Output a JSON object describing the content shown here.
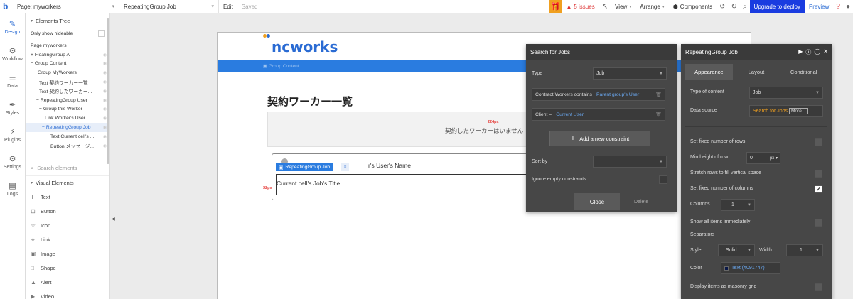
{
  "topbar": {
    "logo": "b",
    "page_select": "Page: myworkers",
    "element_select": "RepeatingGroup Job",
    "edit": "Edit",
    "saved": "Saved",
    "issues": "5 issues",
    "view": "View",
    "arrange": "Arrange",
    "components": "Components",
    "upgrade": "Upgrade to deploy",
    "preview": "Preview"
  },
  "leftnav": {
    "items": [
      {
        "label": "Design",
        "icon": "design-icon",
        "glyph": "✎"
      },
      {
        "label": "Workflow",
        "icon": "workflow-icon",
        "glyph": "⚙"
      },
      {
        "label": "Data",
        "icon": "data-icon",
        "glyph": "☰"
      },
      {
        "label": "Styles",
        "icon": "brush-icon",
        "glyph": "✒"
      },
      {
        "label": "Plugins",
        "icon": "plug-icon",
        "glyph": "⚡"
      },
      {
        "label": "Settings",
        "icon": "gear-icon",
        "glyph": "⚙"
      },
      {
        "label": "Logs",
        "icon": "logs-icon",
        "glyph": "▤"
      }
    ]
  },
  "elements_panel": {
    "title": "Elements Tree",
    "only_show_hideable": "Only show hideable",
    "tree": [
      {
        "label": "Page myworkers",
        "indent": 0,
        "selected": false
      },
      {
        "label": "+ FloatingGroup A",
        "indent": 0,
        "selected": false
      },
      {
        "label": "− Group Content",
        "indent": 0,
        "selected": false
      },
      {
        "label": "− Group MyWorkers",
        "indent": 1,
        "selected": false
      },
      {
        "label": "Text 契約ワーカー一覧",
        "indent": 3,
        "selected": false
      },
      {
        "label": "Text 契約したワーカー...",
        "indent": 3,
        "selected": false
      },
      {
        "label": "− RepeatingGroup User",
        "indent": 2,
        "selected": false
      },
      {
        "label": "− Group this Worker",
        "indent": 3,
        "selected": false
      },
      {
        "label": "Link Worker's User",
        "indent": 5,
        "selected": false
      },
      {
        "label": "− RepeatingGroup Job",
        "indent": 4,
        "selected": true
      },
      {
        "label": "Text Current cell's ...",
        "indent": 7,
        "selected": false
      },
      {
        "label": "Button メッセージ...",
        "indent": 7,
        "selected": false
      }
    ],
    "search_placeholder": "Search elements",
    "visual_elements_title": "Visual Elements",
    "visual_elements": [
      {
        "label": "Text",
        "glyph": "T",
        "icon": "text-icon"
      },
      {
        "label": "Button",
        "glyph": "⊡",
        "icon": "button-icon"
      },
      {
        "label": "Icon",
        "glyph": "☆",
        "icon": "star-icon"
      },
      {
        "label": "Link",
        "glyph": "⚭",
        "icon": "link-icon"
      },
      {
        "label": "Image",
        "glyph": "▣",
        "icon": "image-icon"
      },
      {
        "label": "Shape",
        "glyph": "□",
        "icon": "shape-icon"
      },
      {
        "label": "Alert",
        "glyph": "▲",
        "icon": "alert-icon"
      },
      {
        "label": "Video",
        "glyph": "▶",
        "icon": "video-icon"
      }
    ]
  },
  "canvas": {
    "logo": "ncworks",
    "band_label": "▣ Group Content",
    "page_title": "契約ワーカー一覧",
    "empty_text": "契約したワーカーはいません",
    "card_text1": "r's User's Name",
    "card_text2": "Current cell's Job's Title",
    "rg_chip": "RepeatingGroup Job",
    "guide_224": "224px",
    "guide_32": "32px"
  },
  "search_panel": {
    "title": "Search for Jobs",
    "type_label": "Type",
    "type_value": "Job",
    "constraint1_label": "Contract Workers contains",
    "constraint1_value": "Parent group's User",
    "constraint2_label": "Client =",
    "constraint2_value": "Current User",
    "add_constraint": "Add a new constraint",
    "sort_by": "Sort by",
    "ignore_empty": "Ignore empty constraints",
    "close": "Close",
    "delete": "Delete"
  },
  "property_editor": {
    "title": "RepeatingGroup Job",
    "tabs": [
      "Appearance",
      "Layout",
      "Conditional"
    ],
    "type_of_content_label": "Type of content",
    "type_of_content_value": "Job",
    "data_source_label": "Data source",
    "data_source_value": "Search for Jobs",
    "data_source_more": "More...",
    "fixed_rows": "Set fixed number of rows",
    "min_height": "Min height of row",
    "min_height_value": "0",
    "min_height_unit": "px",
    "stretch_rows": "Stretch rows to fill vertical space",
    "fixed_columns": "Set fixed number of columns",
    "columns_label": "Columns",
    "columns_value": "1",
    "show_all": "Show all items immediately",
    "separators": "Separators",
    "style_label": "Style",
    "style_value": "Solid",
    "width_label": "Width",
    "width_value": "1",
    "color_label": "Color",
    "color_value": "Text (#091747)",
    "masonry": "Display items as masonry grid"
  },
  "colors": {
    "accent": "#2a6bd3",
    "upgrade": "#1a3ce0",
    "panel_dark": "#474747",
    "guide_red": "#e53935",
    "separator_color": "#091747"
  }
}
